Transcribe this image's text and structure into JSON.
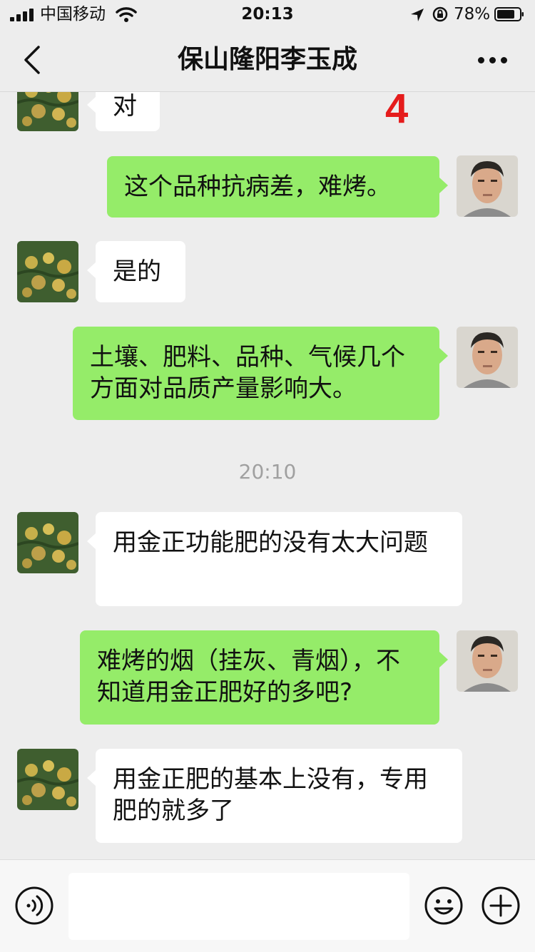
{
  "status_bar": {
    "carrier": "中国移动",
    "time": "20:13",
    "battery": "78%"
  },
  "nav": {
    "title": "保山隆阳李玉成"
  },
  "overlay": {
    "number": "4"
  },
  "messages": [
    {
      "side": "in",
      "text": "对"
    },
    {
      "side": "out",
      "text": "这个品种抗病差，难烤。"
    },
    {
      "side": "in",
      "text": "是的"
    },
    {
      "side": "out",
      "text": "土壤、肥料、品种、气候几个方面对品质产量影响大。"
    },
    {
      "side": "in",
      "text": "用金正功能肥的没有太大问题"
    },
    {
      "side": "out",
      "text": "难烤的烟（挂灰、青烟），不知道用金正肥好的多吧?"
    },
    {
      "side": "in",
      "text": "用金正肥的基本上没有，专用肥的就多了"
    }
  ],
  "timestamp": "20:10",
  "colors": {
    "background": "#ededed",
    "outgoing_bubble": "#95ec69",
    "incoming_bubble": "#ffffff",
    "overlay_number": "#e51c1c"
  },
  "icons": {
    "back": "chevron-left-icon",
    "more": "more-dots-icon",
    "voice": "voice-icon",
    "emoji": "emoji-icon",
    "plus": "plus-icon"
  }
}
